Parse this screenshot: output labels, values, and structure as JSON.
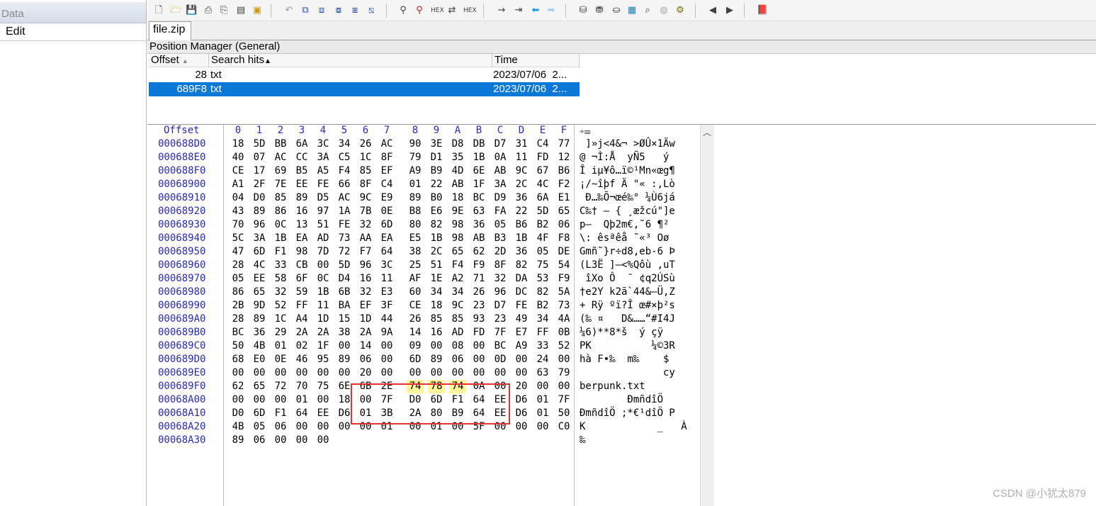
{
  "left_panel": {
    "header": "Data",
    "menu_item": "Edit"
  },
  "toolbar": {
    "icons": [
      "new-file-icon",
      "open-file-icon",
      "save-icon",
      "print-icon",
      "print-preview-icon",
      "properties-icon",
      "open-folder-icon",
      "undo-icon",
      "copy-icon",
      "cut-icon",
      "paste-icon",
      "paste-special-icon",
      "copy-hex-icon",
      "find-icon",
      "find-hex-icon",
      "find-hex-text-icon",
      "replace-icon",
      "replace-hex-icon",
      "goto-icon",
      "goto-offset-icon",
      "back-icon",
      "forward-icon",
      "disk-icon",
      "disk-stack-icon",
      "ram-icon",
      "calculator-icon",
      "search-icon",
      "analysis-icon",
      "gear-icon",
      "prev-block-icon",
      "next-block-icon",
      "book-icon"
    ]
  },
  "tabs": {
    "file": "file.zip"
  },
  "position_manager": {
    "title": "Position Manager (General)",
    "columns": [
      "Offset",
      "Search hits",
      "Time"
    ],
    "rows": [
      {
        "offset": "28",
        "hits": "txt",
        "time": "2023/07/06  2...",
        "selected": false
      },
      {
        "offset": "689F8",
        "hits": "txt",
        "time": "2023/07/06  2...",
        "selected": true
      }
    ]
  },
  "hex": {
    "offset_label": "Offset",
    "col_headers": [
      "0",
      "1",
      "2",
      "3",
      "4",
      "5",
      "6",
      "7",
      "8",
      "9",
      "A",
      "B",
      "C",
      "D",
      "E",
      "F"
    ],
    "lines": [
      {
        "offset": "000688D0",
        "bytes": [
          "18",
          "5D",
          "BB",
          "6A",
          "3C",
          "34",
          "26",
          "AC",
          "90",
          "3E",
          "D8",
          "DB",
          "D7",
          "31",
          "C4",
          "77"
        ],
        "ascii": " ]»j<4&¬ >ØÛ×1Äw"
      },
      {
        "offset": "000688E0",
        "bytes": [
          "40",
          "07",
          "AC",
          "CC",
          "3A",
          "C5",
          "1C",
          "8F",
          "79",
          "D1",
          "35",
          "1B",
          "0A",
          "11",
          "FD",
          "12"
        ],
        "ascii": "@ ¬Ì:Å  yÑ5   ý "
      },
      {
        "offset": "000688F0",
        "bytes": [
          "CE",
          "17",
          "69",
          "B5",
          "A5",
          "F4",
          "85",
          "EF",
          "A9",
          "B9",
          "4D",
          "6E",
          "AB",
          "9C",
          "67",
          "B6"
        ],
        "ascii": "Î iµ¥ô…ï©¹Mn«œg¶"
      },
      {
        "offset": "00068900",
        "bytes": [
          "A1",
          "2F",
          "7E",
          "EE",
          "FE",
          "66",
          "8F",
          "C4",
          "01",
          "22",
          "AB",
          "1F",
          "3A",
          "2C",
          "4C",
          "F2"
        ],
        "ascii": "¡/~îþf Ä \"« :,Lò"
      },
      {
        "offset": "00068910",
        "bytes": [
          "04",
          "D0",
          "85",
          "89",
          "D5",
          "AC",
          "9C",
          "E9",
          "89",
          "B0",
          "18",
          "BC",
          "D9",
          "36",
          "6A",
          "E1"
        ],
        "ascii": " Ð…‰Õ¬œé‰° ¼Ù6já"
      },
      {
        "offset": "00068920",
        "bytes": [
          "43",
          "89",
          "86",
          "16",
          "97",
          "1A",
          "7B",
          "0E",
          "B8",
          "E6",
          "9E",
          "63",
          "FA",
          "22",
          "5D",
          "65"
        ],
        "ascii": "C‰† — { ¸æžcú\"]e"
      },
      {
        "offset": "00068930",
        "bytes": [
          "70",
          "96",
          "0C",
          "13",
          "51",
          "FE",
          "32",
          "6D",
          "80",
          "82",
          "98",
          "36",
          "05",
          "B6",
          "B2",
          "06"
        ],
        "ascii": "p–  Qþ2m€‚˜6 ¶² "
      },
      {
        "offset": "00068940",
        "bytes": [
          "5C",
          "3A",
          "1B",
          "EA",
          "AD",
          "73",
          "AA",
          "EA",
          "E5",
          "1B",
          "98",
          "AB",
          "B3",
          "1B",
          "4F",
          "F8"
        ],
        "ascii": "\\: ê­sªêå ˜«³ Oø"
      },
      {
        "offset": "00068950",
        "bytes": [
          "47",
          "6D",
          "F1",
          "98",
          "7D",
          "72",
          "F7",
          "64",
          "38",
          "2C",
          "65",
          "62",
          "2D",
          "36",
          "05",
          "DE"
        ],
        "ascii": "Gmñ˜}r÷d8,eb-6 Þ"
      },
      {
        "offset": "00068960",
        "bytes": [
          "28",
          "4C",
          "33",
          "CB",
          "00",
          "5D",
          "96",
          "3C",
          "25",
          "51",
          "F4",
          "F9",
          "8F",
          "82",
          "75",
          "54"
        ],
        "ascii": "(L3Ë ]–<%Qôù ‚uT"
      },
      {
        "offset": "00068970",
        "bytes": [
          "05",
          "EE",
          "58",
          "6F",
          "0C",
          "D4",
          "16",
          "11",
          "AF",
          "1E",
          "A2",
          "71",
          "32",
          "DA",
          "53",
          "F9"
        ],
        "ascii": " îXo Ô  ¯ ¢q2ÚSù"
      },
      {
        "offset": "00068980",
        "bytes": [
          "86",
          "65",
          "32",
          "59",
          "1B",
          "6B",
          "32",
          "E3",
          "60",
          "34",
          "34",
          "26",
          "96",
          "DC",
          "82",
          "5A"
        ],
        "ascii": "†e2Y k2ã`44&–Ü‚Z"
      },
      {
        "offset": "00068990",
        "bytes": [
          "2B",
          "9D",
          "52",
          "FF",
          "11",
          "BA",
          "EF",
          "3F",
          "CE",
          "18",
          "9C",
          "23",
          "D7",
          "FE",
          "B2",
          "73"
        ],
        "ascii": "+ Rÿ ºï?Î œ#×þ²s"
      },
      {
        "offset": "000689A0",
        "bytes": [
          "28",
          "89",
          "1C",
          "A4",
          "1D",
          "15",
          "1D",
          "44",
          "26",
          "85",
          "85",
          "93",
          "23",
          "49",
          "34",
          "4A"
        ],
        "ascii": "(‰ ¤   D&……“#I4J"
      },
      {
        "offset": "000689B0",
        "bytes": [
          "BC",
          "36",
          "29",
          "2A",
          "2A",
          "38",
          "2A",
          "9A",
          "14",
          "16",
          "AD",
          "FD",
          "7F",
          "E7",
          "FF",
          "0B"
        ],
        "ascii": "¼6)**8*š  ­ý çÿ "
      },
      {
        "offset": "000689C0",
        "bytes": [
          "50",
          "4B",
          "01",
          "02",
          "1F",
          "00",
          "14",
          "00",
          "09",
          "00",
          "08",
          "00",
          "BC",
          "A9",
          "33",
          "52"
        ],
        "ascii": "PK          ¼©3R"
      },
      {
        "offset": "000689D0",
        "bytes": [
          "68",
          "E0",
          "0E",
          "46",
          "95",
          "89",
          "06",
          "00",
          "6D",
          "89",
          "06",
          "00",
          "0D",
          "00",
          "24",
          "00"
        ],
        "ascii": "hà F•‰  m‰    $ "
      },
      {
        "offset": "000689E0",
        "bytes": [
          "00",
          "00",
          "00",
          "00",
          "00",
          "00",
          "20",
          "00",
          "00",
          "00",
          "00",
          "00",
          "00",
          "00",
          "63",
          "79"
        ],
        "ascii": "              cy"
      },
      {
        "offset": "000689F0",
        "bytes": [
          "62",
          "65",
          "72",
          "70",
          "75",
          "6E",
          "6B",
          "2E",
          "74",
          "78",
          "74",
          "0A",
          "00",
          "20",
          "00",
          "00"
        ],
        "ascii": "berpunk.txt     "
      },
      {
        "offset": "00068A00",
        "bytes": [
          "00",
          "00",
          "00",
          "01",
          "00",
          "18",
          "00",
          "7F",
          "D0",
          "6D",
          "F1",
          "64",
          "EE",
          "D6",
          "01",
          "7F"
        ],
        "ascii": "        ÐmñdîÖ  "
      },
      {
        "offset": "00068A10",
        "bytes": [
          "D0",
          "6D",
          "F1",
          "64",
          "EE",
          "D6",
          "01",
          "3B",
          "2A",
          "80",
          "B9",
          "64",
          "EE",
          "D6",
          "01",
          "50"
        ],
        "ascii": "ÐmñdîÖ ;*€¹dîÖ P"
      },
      {
        "offset": "00068A20",
        "bytes": [
          "4B",
          "05",
          "06",
          "00",
          "00",
          "00",
          "00",
          "01",
          "00",
          "01",
          "00",
          "5F",
          "00",
          "00",
          "00",
          "C0"
        ],
        "ascii": "K            _   À"
      },
      {
        "offset": "00068A30",
        "bytes": [
          "89",
          "06",
          "00",
          "00",
          "00"
        ],
        "ascii": "‰"
      }
    ]
  },
  "watermark": "CSDN @小犹太879"
}
